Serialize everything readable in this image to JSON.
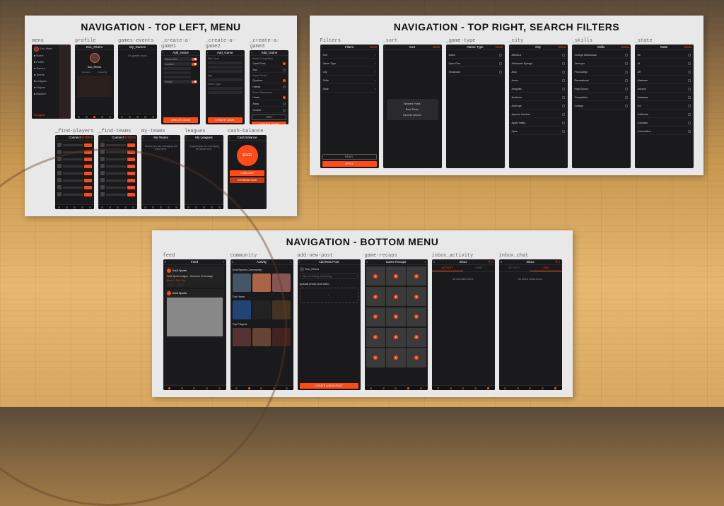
{
  "panels": {
    "topleft": {
      "title": "NAVIGATION - TOP LEFT, MENU"
    },
    "topright": {
      "title": "NAVIGATION - TOP RIGHT, SEARCH FILTERS"
    },
    "bottom": {
      "title": "NAVIGATION - BOTTOM MENU"
    }
  },
  "screens": {
    "menu": {
      "label": "menu",
      "title": "",
      "items": [
        "My_Home",
        "Profile",
        "Games",
        "Teams",
        "Leagues",
        "Players",
        "Balance"
      ]
    },
    "profile": {
      "label": "profile",
      "title": "",
      "name": "Doc_Rivers"
    },
    "games_events": {
      "label": "games-events",
      "title": "My_Games",
      "empty": "No games found"
    },
    "create1": {
      "label": "_create-a-game1",
      "title": "Add_Game",
      "btn": "CREATE GAME"
    },
    "create2": {
      "label": "_create-a-game2",
      "title": "Add_Game",
      "btn": "CREATE GAME"
    },
    "create3": {
      "label": "_create-a-game3",
      "title": "Add_Game",
      "opts": [
        "Game Competition",
        "Open Runs",
        "Aau",
        "Game Period",
        "Quarters",
        "Halves",
        "Game Placement",
        "Home",
        "Away",
        "Neutral"
      ],
      "btn": "CREATE GAME"
    },
    "find_players": {
      "label": "_find-players",
      "header": "Connect",
      "filters": "FILTERS"
    },
    "find_teams": {
      "label": "_find-teams",
      "header": "Connect",
      "filters": "FILTERS"
    },
    "my_teams": {
      "label": "my-teams",
      "title": "My Teams",
      "text": "Teams you are managing will show here."
    },
    "leagues": {
      "label": "leagues",
      "title": "My Leagues",
      "text": "Leagues you are managing will show here."
    },
    "cash": {
      "label": "cash-balance",
      "title": "Cash Balance",
      "amount": "$0.00",
      "btn1": "LOAD CASH",
      "btn2": "WITHDRAW CASH"
    },
    "filters": {
      "label": "Filters",
      "title": "Filters",
      "done": "Done",
      "rows": [
        "Sort",
        "Game Type",
        "City",
        "Skills",
        "State"
      ],
      "reset": "RESET",
      "apply": "APPLY"
    },
    "sort": {
      "label": "_sort",
      "title": "Sort",
      "done": "Done",
      "opts": [
        "Newest Posts",
        "Best Posts",
        "Newest Games"
      ]
    },
    "game_type": {
      "label": "_game-type",
      "title": "Game Type",
      "done": "Done",
      "rows": [
        "Game",
        "Open Run",
        "Showcase"
      ]
    },
    "city": {
      "label": "_city",
      "title": "City",
      "done": "Done",
      "rows": [
        "Afton/La",
        "Altamonte Springs",
        "Alva",
        "Ames",
        "Antigüita",
        "Anaheim",
        "Antelope",
        "Apache Junction",
        "Apple Valley",
        "Apex"
      ]
    },
    "skills": {
      "label": "_skills",
      "title": "Skills",
      "done": "Done",
      "rows": [
        "College Intramurals",
        "Semi-pro",
        "Pro/College",
        "Recreational",
        "High School",
        "Competitive",
        "College"
      ]
    },
    "state": {
      "label": "_state",
      "title": "State",
      "done": "Done",
      "rows": [
        "AK",
        "AL",
        "AR",
        "Alabama",
        "Arizona",
        "Arkansas",
        "CA",
        "California",
        "Colorado",
        "Connecticut"
      ]
    },
    "feed": {
      "label": "feed",
      "title": "Feed",
      "user": "Xvs5 Sports",
      "league": "Xvs5 Sports League - Women's Scrimmage",
      "tag": "Week 1 • 3v3 • Pro"
    },
    "community": {
      "label": "community",
      "title": "Activity",
      "sec1": "Xvs5Sports Community",
      "sec2": "Top Hosts",
      "sec3": "Top Players"
    },
    "add_post": {
      "label": "add-new-post",
      "title": "Add New Post",
      "user": "Doc_Rivers",
      "ph": "Say something interesting",
      "up": "Upload photo and video",
      "btn": "CREATE A NEW POST"
    },
    "recaps": {
      "label": "game-recaps",
      "title": "Game Recaps"
    },
    "inbox_act": {
      "label": "inbox_activity",
      "title": "Inbox",
      "act": "ACTIVITY",
      "chat": "CHAT",
      "empty": "No activities found."
    },
    "inbox_chat": {
      "label": "inbox_chat",
      "title": "Inbox",
      "act": "ACTIVITY",
      "chat": "CHAT",
      "empty": "No direct chats found."
    }
  }
}
